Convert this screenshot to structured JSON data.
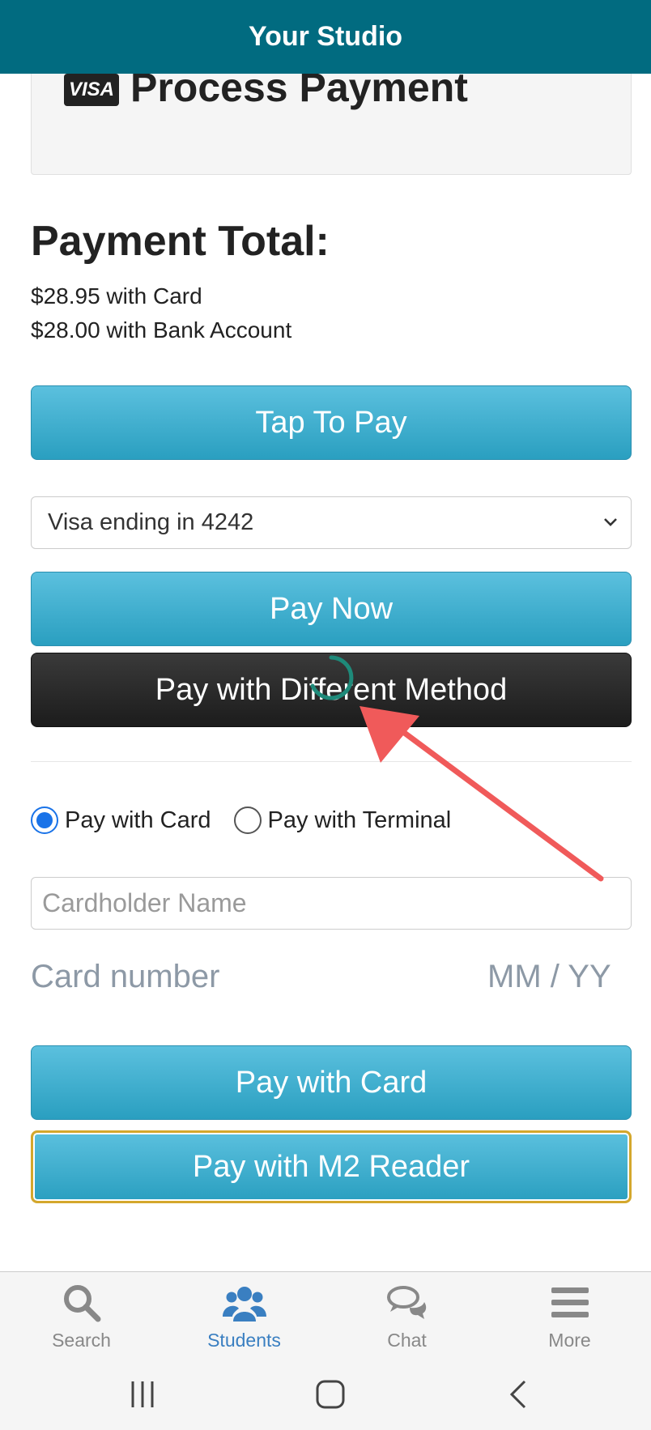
{
  "header": {
    "title": "Your Studio"
  },
  "process_panel": {
    "visa_logo": "VISA",
    "title": "Process Payment"
  },
  "payment_total": {
    "title": "Payment Total:",
    "card_line": "$28.95 with Card",
    "bank_line": "$28.00 with Bank Account"
  },
  "buttons": {
    "tap_to_pay": "Tap To Pay",
    "pay_now": "Pay Now",
    "pay_different": "Pay with Different Method",
    "pay_with_card": "Pay with Card",
    "pay_with_m2": "Pay with M2 Reader"
  },
  "saved_card_select": {
    "selected": "Visa ending in 4242"
  },
  "payment_mode": {
    "options": [
      "Pay with Card",
      "Pay with Terminal"
    ],
    "selected": "Pay with Card"
  },
  "card_form": {
    "cardholder_placeholder": "Cardholder Name",
    "card_number_placeholder": "Card number",
    "expiry_placeholder": "MM / YY"
  },
  "bottom_nav": {
    "items": [
      {
        "label": "Search",
        "icon": "search-icon"
      },
      {
        "label": "Students",
        "icon": "users-icon",
        "active": true
      },
      {
        "label": "Chat",
        "icon": "chat-icon"
      },
      {
        "label": "More",
        "icon": "menu-icon"
      }
    ]
  },
  "colors": {
    "header_bg": "#016b80",
    "button_blue": "#3aaed0",
    "button_dark": "#2a2a2a",
    "active_nav": "#3a7fc1",
    "annotation_arrow": "#f05a5a",
    "m2_border": "#d4a72c"
  }
}
